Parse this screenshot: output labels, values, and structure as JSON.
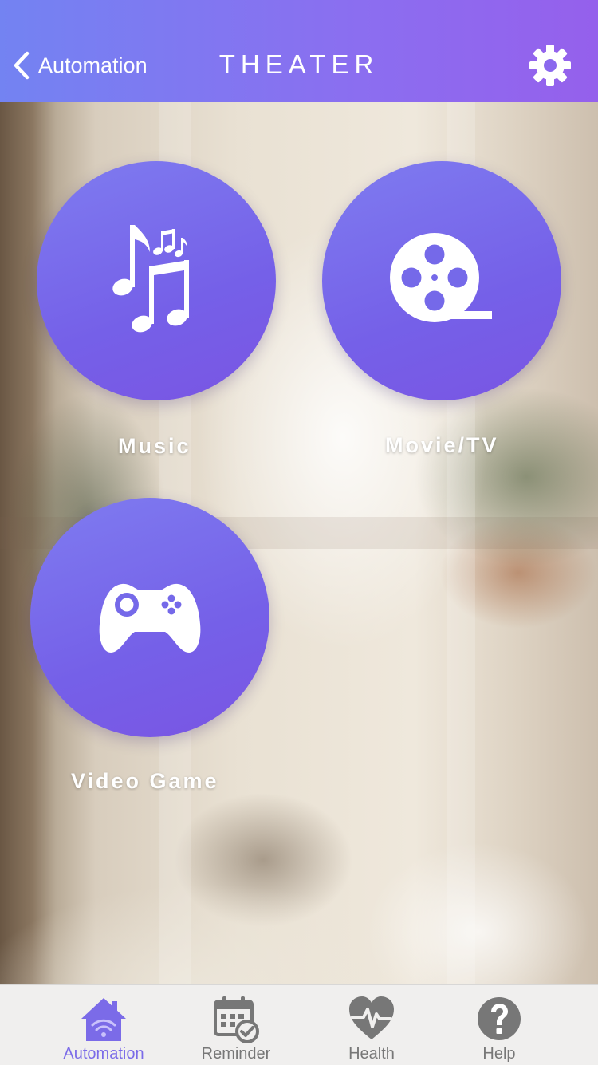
{
  "header": {
    "back_label": "Automation",
    "title": "THEATER"
  },
  "tiles": [
    {
      "label": "Music",
      "icon": "music-notes-icon"
    },
    {
      "label": "Movie/TV",
      "icon": "film-reel-icon"
    },
    {
      "label": "Video Game",
      "icon": "gamepad-icon"
    }
  ],
  "tabbar": {
    "items": [
      {
        "label": "Automation",
        "icon": "home-wifi-icon",
        "active": true
      },
      {
        "label": "Reminder",
        "icon": "calendar-check-icon",
        "active": false
      },
      {
        "label": "Health",
        "icon": "heart-pulse-icon",
        "active": false
      },
      {
        "label": "Help",
        "icon": "question-icon",
        "active": false
      }
    ]
  },
  "colors": {
    "accent": "#7B6BE8",
    "header_start": "#7383F2",
    "header_end": "#9560EC",
    "inactive_tab": "#777777"
  }
}
